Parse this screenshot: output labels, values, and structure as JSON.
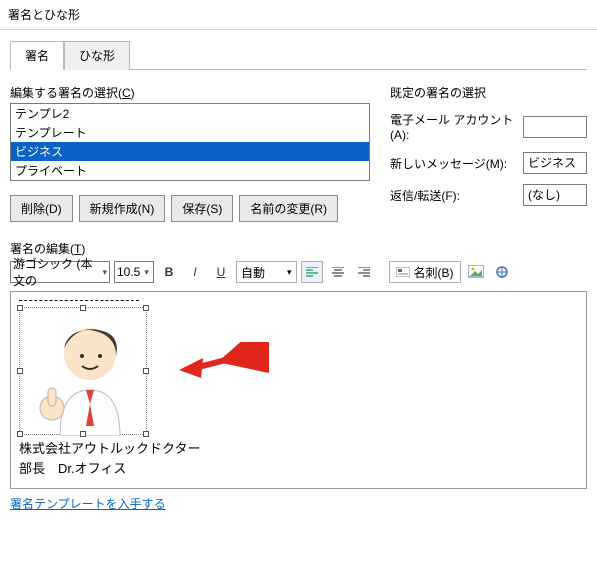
{
  "window": {
    "title": "署名とひな形"
  },
  "tabs": {
    "sign": "署名",
    "template": "ひな形"
  },
  "left": {
    "list_label_pre": "編集する署名の選択(",
    "list_label_u": "C",
    "list_label_post": ")",
    "items": [
      "テンプレ2",
      "テンプレート",
      "ビジネス",
      "プライベート"
    ],
    "selected_index": 2,
    "btn_delete": "削除(D)",
    "btn_new": "新規作成(N)",
    "btn_save": "保存(S)",
    "btn_rename": "名前の変更(R)"
  },
  "right": {
    "header": "既定の署名の選択",
    "account_label": "電子メール アカウント(A):",
    "account_value": "",
    "newmsg_label": "新しいメッセージ(M):",
    "newmsg_value": "ビジネス",
    "reply_label": "返信/転送(F):",
    "reply_value": "(なし)"
  },
  "editor": {
    "label_pre": "署名の編集(",
    "label_u": "T",
    "label_post": ")",
    "font": "游ゴシック (本文の",
    "size": "10.5",
    "color_label": "自動",
    "card_label": "名刺(B)",
    "company": "株式会社アウトルックドクター",
    "role_line": "部長　Dr.オフィス",
    "link": "署名テンプレートを入手する"
  }
}
